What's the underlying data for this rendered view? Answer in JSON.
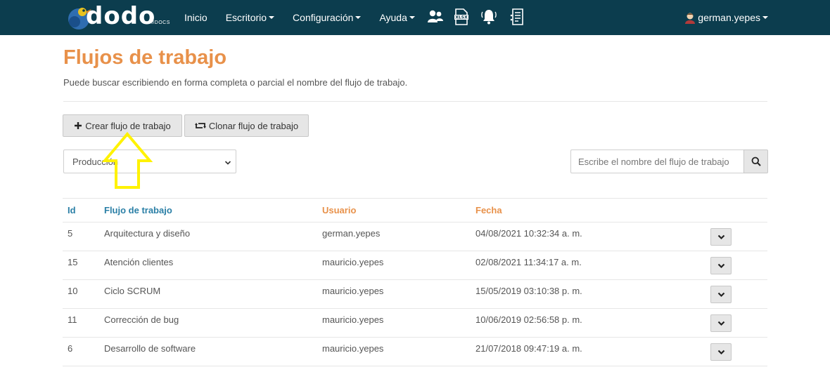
{
  "brand": {
    "logo_text": "dodo",
    "logo_sub": "DOCS",
    "logo_mark": "®",
    "colors": {
      "navbar": "#0c3d4e",
      "title": "#e8914a",
      "header_blue": "#2a7fa6",
      "header_orange": "#e8914a",
      "annotation": "#fff200"
    }
  },
  "nav": {
    "items": [
      {
        "label": "Inicio",
        "has_caret": false
      },
      {
        "label": "Escritorio",
        "has_caret": true
      },
      {
        "label": "Configuración",
        "has_caret": true
      },
      {
        "label": "Ayuda",
        "has_caret": true
      }
    ],
    "icons": [
      "users-icon",
      "xlsx-file-icon",
      "bell-icon",
      "report-list-icon"
    ],
    "user": "german.yepes"
  },
  "page": {
    "title": "Flujos de trabajo",
    "subtitle": "Puede buscar escribiendo en forma completa o parcial el nombre del flujo de trabajo."
  },
  "toolbar": {
    "create_label": "Crear flujo de trabajo",
    "clone_label": "Clonar flujo de trabajo"
  },
  "filter": {
    "selected": "Producción"
  },
  "search": {
    "placeholder": "Escribe el nombre del flujo de trabajo"
  },
  "table": {
    "headers": {
      "id": "Id",
      "flow": "Flujo de trabajo",
      "user": "Usuario",
      "date": "Fecha"
    },
    "rows": [
      {
        "id": "5",
        "flow": "Arquitectura y diseño",
        "user": "german.yepes",
        "date": "04/08/2021 10:32:34 a. m."
      },
      {
        "id": "15",
        "flow": "Atención clientes",
        "user": "mauricio.yepes",
        "date": "02/08/2021 11:34:17 a. m."
      },
      {
        "id": "10",
        "flow": "Ciclo SCRUM",
        "user": "mauricio.yepes",
        "date": "15/05/2019 03:10:38 p. m."
      },
      {
        "id": "11",
        "flow": "Corrección de bug",
        "user": "mauricio.yepes",
        "date": "10/06/2019 02:56:58 p. m."
      },
      {
        "id": "6",
        "flow": "Desarrollo de software",
        "user": "mauricio.yepes",
        "date": "21/07/2018 09:47:19 a. m."
      }
    ]
  }
}
